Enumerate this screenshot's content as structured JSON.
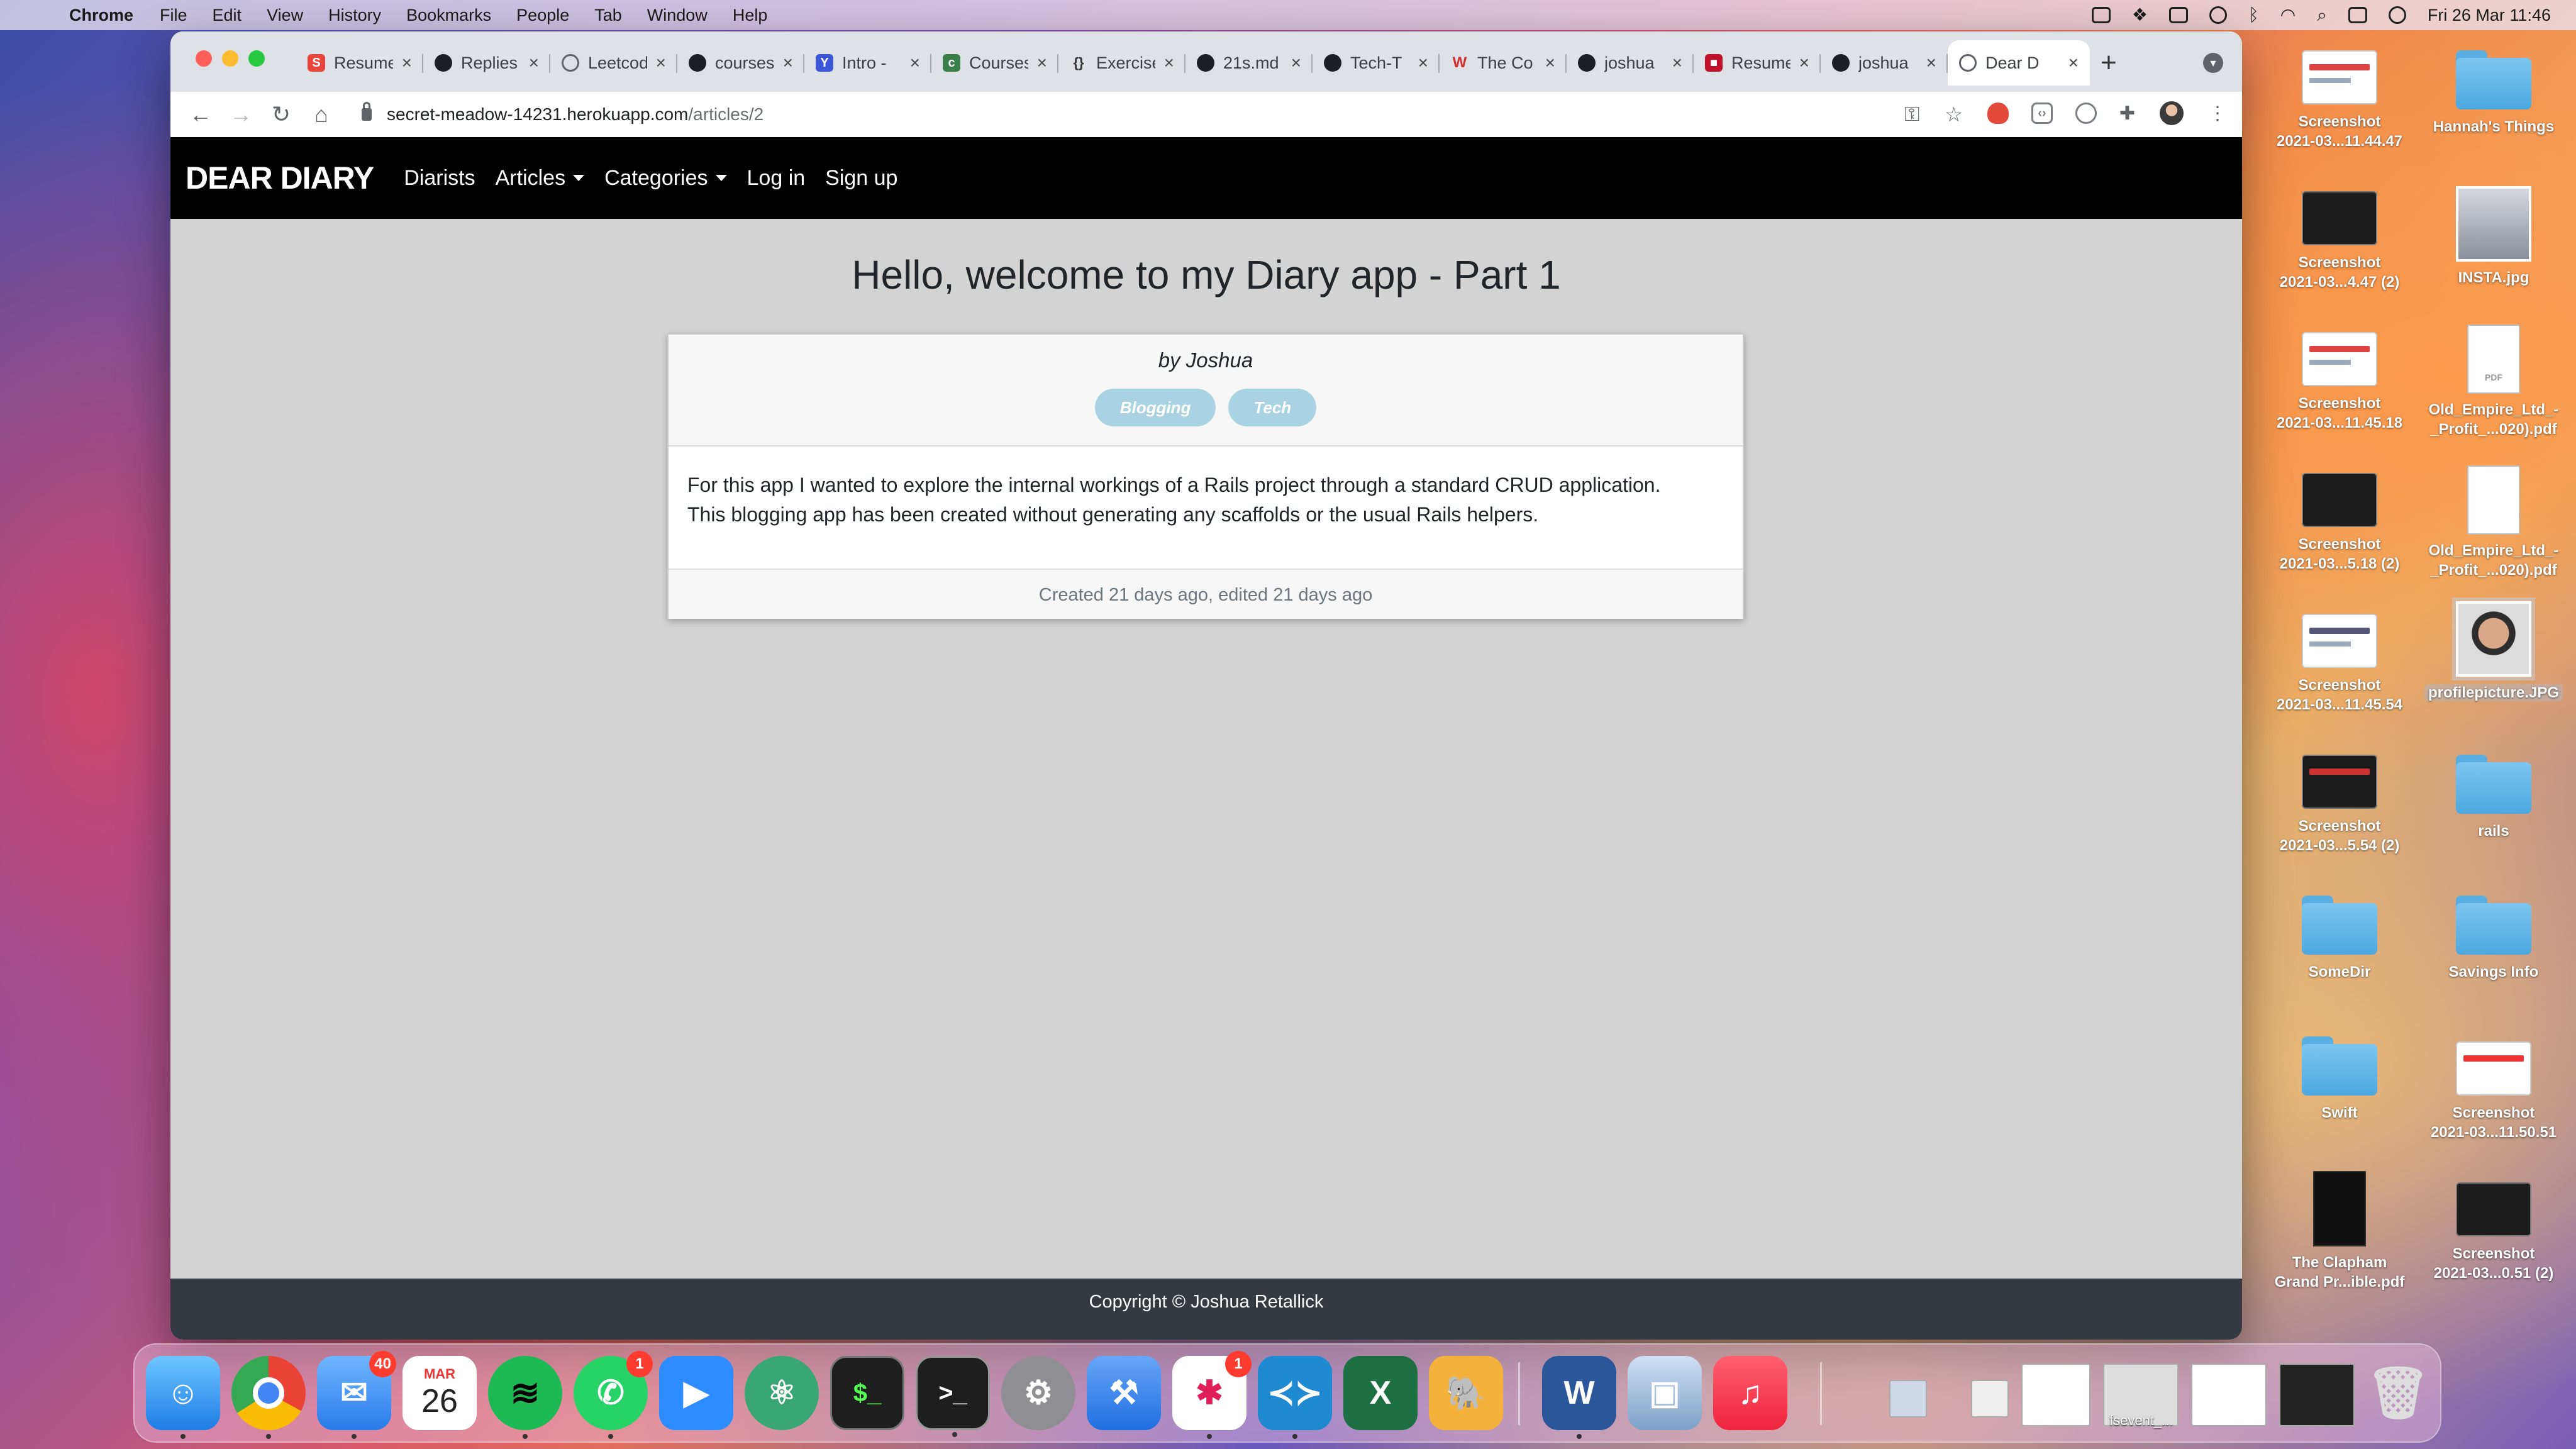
{
  "menubar": {
    "app_name": "Chrome",
    "menus": [
      "File",
      "Edit",
      "View",
      "History",
      "Bookmarks",
      "People",
      "Tab",
      "Window",
      "Help"
    ],
    "clock": "Fri 26 Mar  11:46"
  },
  "browser": {
    "tabs": [
      {
        "title": "Resume",
        "icon": "s-icon",
        "color": "#e8453c"
      },
      {
        "title": "Replies",
        "icon": "github-icon",
        "color": "#1b1f23"
      },
      {
        "title": "Leetcode",
        "icon": "globe-icon",
        "color": "#5f6368"
      },
      {
        "title": "courses",
        "icon": "github-icon",
        "color": "#1b1f23"
      },
      {
        "title": "Intro -",
        "icon": "y-icon",
        "color": "#3c56d8"
      },
      {
        "title": "Courses",
        "icon": "course-icon",
        "color": "#3a7f4a"
      },
      {
        "title": "Exercises",
        "icon": "braces-icon",
        "color": "#333333"
      },
      {
        "title": "21s.md",
        "icon": "github-icon",
        "color": "#1b1f23"
      },
      {
        "title": "Tech-T",
        "icon": "github-icon",
        "color": "#1b1f23"
      },
      {
        "title": "The Co",
        "icon": "w-icon",
        "color": "#d22f2f"
      },
      {
        "title": "joshua",
        "icon": "github-icon",
        "color": "#1b1f23"
      },
      {
        "title": "Resume",
        "icon": "r-icon",
        "color": "#c0102a"
      },
      {
        "title": "joshua",
        "icon": "github-icon",
        "color": "#1b1f23"
      },
      {
        "title": "Dear D",
        "icon": "globe-icon",
        "color": "#5f6368"
      }
    ],
    "url_host": "secret-meadow-14231.herokuapp.com",
    "url_path": "/articles/2"
  },
  "site": {
    "brand": "DEAR DIARY",
    "nav": {
      "diarists": "Diarists",
      "articles": "Articles",
      "categories": "Categories",
      "login": "Log in",
      "signup": "Sign up"
    },
    "article": {
      "title": "Hello, welcome to my Diary app - Part 1",
      "byline": "by Joshua",
      "tags": [
        "Blogging",
        "Tech"
      ],
      "body_line1": "For this app I wanted to explore the internal workings of a Rails project through a standard CRUD application.",
      "body_line2": "This blogging app has been created without generating any scaffolds or the usual Rails helpers.",
      "meta": "Created 21 days ago, edited 21 days ago"
    },
    "footer": "Copyright © Joshua Retallick"
  },
  "desktop": {
    "items": [
      {
        "label1": "Screenshot",
        "label2": "2021-03...11.44.47",
        "kind": "shot"
      },
      {
        "label1": "Hannah's Things",
        "label2": "",
        "kind": "folder"
      },
      {
        "label1": "Screenshot",
        "label2": "2021-03...4.47 (2)",
        "kind": "shot-dark"
      },
      {
        "label1": "INSTA.jpg",
        "label2": "",
        "kind": "photo"
      },
      {
        "label1": "Screenshot",
        "label2": "2021-03...11.45.18",
        "kind": "shot"
      },
      {
        "label1": "Old_Empire_Ltd_-",
        "label2": "_Profit_...020).pdf",
        "kind": "pdf"
      },
      {
        "label1": "Screenshot",
        "label2": "2021-03...5.18 (2)",
        "kind": "shot-dark"
      },
      {
        "label1": "Old_Empire_Ltd_-",
        "label2": "_Profit_...020).pdf",
        "kind": "pdf"
      },
      {
        "label1": "Screenshot",
        "label2": "2021-03...11.45.54",
        "kind": "shot"
      },
      {
        "label1": "profilepicture.JPG",
        "label2": "",
        "kind": "face"
      },
      {
        "label1": "Screenshot",
        "label2": "2021-03...5.54 (2)",
        "kind": "shot-dark"
      },
      {
        "label1": "rails",
        "label2": "",
        "kind": "folder"
      },
      {
        "label1": "SomeDir",
        "label2": "",
        "kind": "folder"
      },
      {
        "label1": "Savings Info",
        "label2": "",
        "kind": "folder"
      },
      {
        "label1": "Swift",
        "label2": "",
        "kind": "folder"
      },
      {
        "label1": "Screenshot",
        "label2": "2021-03...11.50.51",
        "kind": "shot"
      },
      {
        "label1": "The Clapham",
        "label2": "Grand Pr...ible.pdf",
        "kind": "poster"
      },
      {
        "label1": "Screenshot",
        "label2": "2021-03...0.51 (2)",
        "kind": "shot-dark"
      }
    ],
    "pdf_tag": "PDF"
  },
  "dock": {
    "mail_badge": "40",
    "calendar_month": "MAR",
    "calendar_day": "26",
    "whatsapp_badge": "1",
    "slack_badge": "1",
    "thumb_label": "fsevent_..."
  }
}
